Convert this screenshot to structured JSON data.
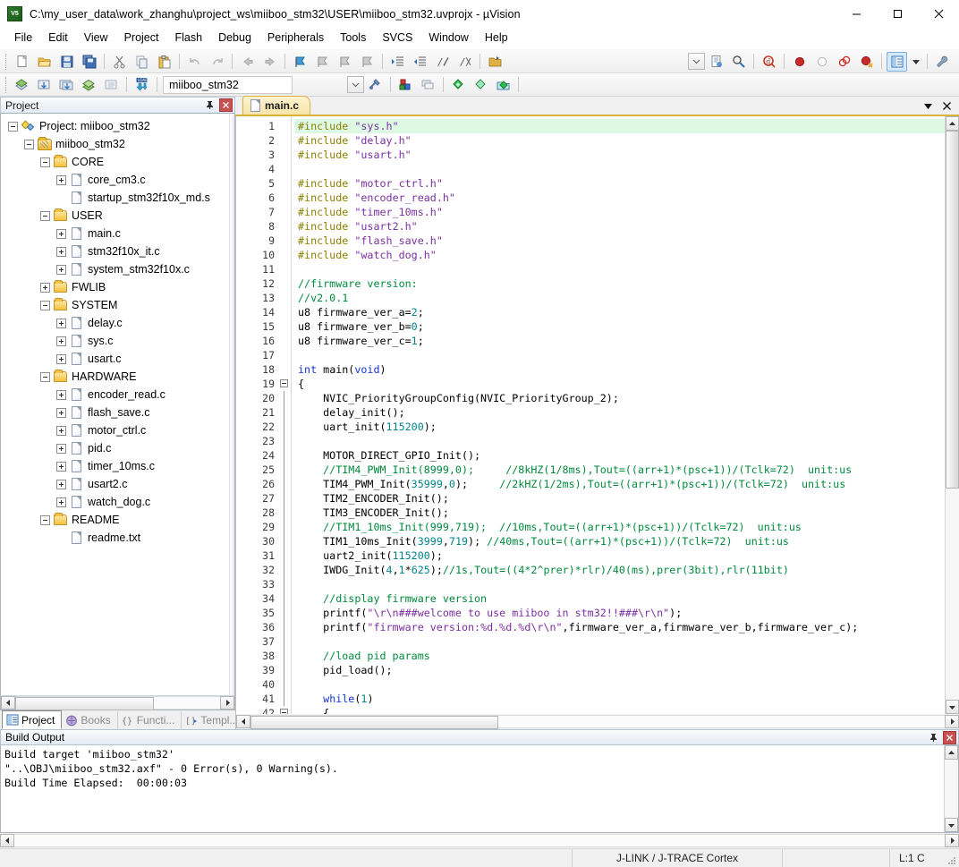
{
  "window": {
    "title": "C:\\my_user_data\\work_zhanghu\\project_ws\\miiboo_stm32\\USER\\miiboo_stm32.uvprojx - µVision",
    "app_icon": "uvision-icon",
    "minimize": "─",
    "maximize": "□",
    "close": "✕"
  },
  "menubar": {
    "items": [
      "File",
      "Edit",
      "View",
      "Project",
      "Flash",
      "Debug",
      "Peripherals",
      "Tools",
      "SVCS",
      "Window",
      "Help"
    ]
  },
  "toolbar_main": {
    "buttons": [
      {
        "name": "new-file",
        "glyph": "□"
      },
      {
        "name": "open-file",
        "glyph": "▤"
      },
      {
        "name": "save",
        "glyph": "■"
      },
      {
        "name": "save-all",
        "glyph": "▣"
      },
      {
        "name": "cut",
        "glyph": "✂"
      },
      {
        "name": "copy",
        "glyph": "❐"
      },
      {
        "name": "paste",
        "glyph": "⎘"
      },
      {
        "name": "undo",
        "glyph": "↶"
      },
      {
        "name": "redo",
        "glyph": "↷"
      },
      {
        "name": "navigate-backward",
        "glyph": "⇐"
      },
      {
        "name": "navigate-forward",
        "glyph": "⇒"
      },
      {
        "name": "insert-bookmark",
        "glyph": "⚑"
      },
      {
        "name": "previous-bookmark",
        "glyph": "⚑"
      },
      {
        "name": "next-bookmark",
        "glyph": "⚑"
      },
      {
        "name": "clear-bookmarks",
        "glyph": "⚑"
      },
      {
        "name": "indent",
        "glyph": "≡"
      },
      {
        "name": "outdent",
        "glyph": "≡"
      },
      {
        "name": "comment-selection",
        "glyph": "//"
      },
      {
        "name": "uncomment-selection",
        "glyph": "//"
      },
      {
        "name": "open-file-under-cursor",
        "glyph": "☰"
      }
    ],
    "right_buttons": [
      {
        "name": "configure-toolbox",
        "glyph": "⌵"
      },
      {
        "name": "find-in-files",
        "glyph": "⌗"
      },
      {
        "name": "find-replace",
        "glyph": "⌘"
      },
      {
        "name": "start-debug-session",
        "glyph": "ⓘ"
      },
      {
        "name": "insert-breakpoint",
        "glyph": "●"
      },
      {
        "name": "disable-breakpoint",
        "glyph": "○"
      },
      {
        "name": "disable-all-breakpoints",
        "glyph": "◍"
      },
      {
        "name": "kill-all-breakpoints",
        "glyph": "●"
      },
      {
        "name": "project-window-toggle",
        "glyph": "▤"
      },
      {
        "name": "project-window-dropdown",
        "glyph": "▾"
      },
      {
        "name": "configure-target-options",
        "glyph": "🔧"
      }
    ]
  },
  "toolbar_build": {
    "buttons": [
      {
        "name": "translate-file",
        "glyph": "◆"
      },
      {
        "name": "build-target",
        "glyph": "▦"
      },
      {
        "name": "rebuild-all-target-files",
        "glyph": "▦"
      },
      {
        "name": "batch-build",
        "glyph": "◈"
      },
      {
        "name": "stop-build",
        "glyph": "▧"
      },
      {
        "name": "download-to-flash",
        "glyph": "LOAD"
      }
    ],
    "target_value": "miiboo_stm32",
    "target_dropdown": "⌄",
    "after_buttons": [
      {
        "name": "manage-project-items",
        "glyph": "⚒"
      },
      {
        "name": "manage-runtime-environment",
        "glyph": "▰"
      },
      {
        "name": "select-software-packs",
        "glyph": "▥"
      },
      {
        "name": "pack-installer",
        "glyph": "◆"
      },
      {
        "name": "manage-multi-project",
        "glyph": "◇"
      },
      {
        "name": "manage-project-folders",
        "glyph": "◉"
      }
    ]
  },
  "project_panel": {
    "caption": "Project",
    "pin_glyph": "·",
    "close_glyph": "✕",
    "tree": [
      {
        "label": "Project: miiboo_stm32",
        "depth": 0,
        "icon": "project-root-icon",
        "expander": "minus"
      },
      {
        "label": "miiboo_stm32",
        "depth": 1,
        "icon": "target-icon",
        "expander": "minus"
      },
      {
        "label": "CORE",
        "depth": 2,
        "icon": "folder-icon",
        "expander": "minus"
      },
      {
        "label": "core_cm3.c",
        "depth": 3,
        "icon": "c-file-icon",
        "expander": "plus"
      },
      {
        "label": "startup_stm32f10x_md.s",
        "depth": 3,
        "icon": "asm-file-icon",
        "expander": "none"
      },
      {
        "label": "USER",
        "depth": 2,
        "icon": "folder-icon",
        "expander": "minus"
      },
      {
        "label": "main.c",
        "depth": 3,
        "icon": "c-file-icon",
        "expander": "plus"
      },
      {
        "label": "stm32f10x_it.c",
        "depth": 3,
        "icon": "c-file-icon",
        "expander": "plus"
      },
      {
        "label": "system_stm32f10x.c",
        "depth": 3,
        "icon": "c-file-icon",
        "expander": "plus"
      },
      {
        "label": "FWLIB",
        "depth": 2,
        "icon": "folder-icon",
        "expander": "plus"
      },
      {
        "label": "SYSTEM",
        "depth": 2,
        "icon": "folder-icon",
        "expander": "minus"
      },
      {
        "label": "delay.c",
        "depth": 3,
        "icon": "c-file-icon",
        "expander": "plus"
      },
      {
        "label": "sys.c",
        "depth": 3,
        "icon": "c-file-icon",
        "expander": "plus"
      },
      {
        "label": "usart.c",
        "depth": 3,
        "icon": "c-file-icon",
        "expander": "plus"
      },
      {
        "label": "HARDWARE",
        "depth": 2,
        "icon": "folder-icon",
        "expander": "minus"
      },
      {
        "label": "encoder_read.c",
        "depth": 3,
        "icon": "c-file-icon",
        "expander": "plus"
      },
      {
        "label": "flash_save.c",
        "depth": 3,
        "icon": "c-file-icon",
        "expander": "plus"
      },
      {
        "label": "motor_ctrl.c",
        "depth": 3,
        "icon": "c-file-icon",
        "expander": "plus"
      },
      {
        "label": "pid.c",
        "depth": 3,
        "icon": "c-file-icon",
        "expander": "plus"
      },
      {
        "label": "timer_10ms.c",
        "depth": 3,
        "icon": "c-file-icon",
        "expander": "plus"
      },
      {
        "label": "usart2.c",
        "depth": 3,
        "icon": "c-file-icon",
        "expander": "plus"
      },
      {
        "label": "watch_dog.c",
        "depth": 3,
        "icon": "c-file-icon",
        "expander": "plus"
      },
      {
        "label": "README",
        "depth": 2,
        "icon": "folder-icon",
        "expander": "minus"
      },
      {
        "label": "readme.txt",
        "depth": 3,
        "icon": "txt-file-icon",
        "expander": "none"
      }
    ],
    "bottom_tabs": [
      {
        "label": "Project",
        "icon": "project-tab-icon",
        "active": true
      },
      {
        "label": "Books",
        "icon": "books-tab-icon",
        "active": false
      },
      {
        "label": "Functi...",
        "icon": "functions-tab-icon",
        "active": false
      },
      {
        "label": "Templ...",
        "icon": "templates-tab-icon",
        "active": false
      }
    ]
  },
  "editor": {
    "tabs": [
      {
        "label": "main.c",
        "icon": "c-file-icon",
        "active": true
      }
    ],
    "tab_dropdown_glyph": "▾",
    "tab_close_glyph": "✕",
    "first_line": 1,
    "lines": [
      {
        "n": 1,
        "fold": "none",
        "cur": true,
        "tok": [
          [
            "pre",
            "#include"
          ],
          [
            "txt",
            " "
          ],
          [
            "str",
            "\"sys.h\""
          ]
        ]
      },
      {
        "n": 2,
        "fold": "none",
        "cur": false,
        "tok": [
          [
            "pre",
            "#include"
          ],
          [
            "txt",
            " "
          ],
          [
            "str",
            "\"delay.h\""
          ]
        ]
      },
      {
        "n": 3,
        "fold": "none",
        "cur": false,
        "tok": [
          [
            "pre",
            "#include"
          ],
          [
            "txt",
            " "
          ],
          [
            "str",
            "\"usart.h\""
          ]
        ]
      },
      {
        "n": 4,
        "fold": "none",
        "cur": false,
        "tok": []
      },
      {
        "n": 5,
        "fold": "none",
        "cur": false,
        "tok": [
          [
            "pre",
            "#include"
          ],
          [
            "txt",
            " "
          ],
          [
            "str",
            "\"motor_ctrl.h\""
          ]
        ]
      },
      {
        "n": 6,
        "fold": "none",
        "cur": false,
        "tok": [
          [
            "pre",
            "#include"
          ],
          [
            "txt",
            " "
          ],
          [
            "str",
            "\"encoder_read.h\""
          ]
        ]
      },
      {
        "n": 7,
        "fold": "none",
        "cur": false,
        "tok": [
          [
            "pre",
            "#include"
          ],
          [
            "txt",
            " "
          ],
          [
            "str",
            "\"timer_10ms.h\""
          ]
        ]
      },
      {
        "n": 8,
        "fold": "none",
        "cur": false,
        "tok": [
          [
            "pre",
            "#include"
          ],
          [
            "txt",
            " "
          ],
          [
            "str",
            "\"usart2.h\""
          ]
        ]
      },
      {
        "n": 9,
        "fold": "none",
        "cur": false,
        "tok": [
          [
            "pre",
            "#include"
          ],
          [
            "txt",
            " "
          ],
          [
            "str",
            "\"flash_save.h\""
          ]
        ]
      },
      {
        "n": 10,
        "fold": "none",
        "cur": false,
        "tok": [
          [
            "pre",
            "#include"
          ],
          [
            "txt",
            " "
          ],
          [
            "str",
            "\"watch_dog.h\""
          ]
        ]
      },
      {
        "n": 11,
        "fold": "none",
        "cur": false,
        "tok": []
      },
      {
        "n": 12,
        "fold": "none",
        "cur": false,
        "tok": [
          [
            "com",
            "//firmware version:"
          ]
        ]
      },
      {
        "n": 13,
        "fold": "none",
        "cur": false,
        "tok": [
          [
            "com",
            "//v2.0.1"
          ]
        ]
      },
      {
        "n": 14,
        "fold": "none",
        "cur": false,
        "tok": [
          [
            "txt",
            "u8 firmware_ver_a="
          ],
          [
            "num",
            "2"
          ],
          [
            "txt",
            ";"
          ]
        ]
      },
      {
        "n": 15,
        "fold": "none",
        "cur": false,
        "tok": [
          [
            "txt",
            "u8 firmware_ver_b="
          ],
          [
            "num",
            "0"
          ],
          [
            "txt",
            ";"
          ]
        ]
      },
      {
        "n": 16,
        "fold": "none",
        "cur": false,
        "tok": [
          [
            "txt",
            "u8 firmware_ver_c="
          ],
          [
            "num",
            "1"
          ],
          [
            "txt",
            ";"
          ]
        ]
      },
      {
        "n": 17,
        "fold": "none",
        "cur": false,
        "tok": []
      },
      {
        "n": 18,
        "fold": "none",
        "cur": false,
        "tok": [
          [
            "key",
            "int"
          ],
          [
            "txt",
            " main("
          ],
          [
            "key",
            "void"
          ],
          [
            "txt",
            ")"
          ]
        ]
      },
      {
        "n": 19,
        "fold": "box",
        "cur": false,
        "tok": [
          [
            "txt",
            "{"
          ]
        ]
      },
      {
        "n": 20,
        "fold": "line",
        "cur": false,
        "tok": [
          [
            "txt",
            "    NVIC_PriorityGroupConfig(NVIC_PriorityGroup_2);"
          ]
        ]
      },
      {
        "n": 21,
        "fold": "line",
        "cur": false,
        "tok": [
          [
            "txt",
            "    delay_init();"
          ]
        ]
      },
      {
        "n": 22,
        "fold": "line",
        "cur": false,
        "tok": [
          [
            "txt",
            "    uart_init("
          ],
          [
            "num",
            "115200"
          ],
          [
            "txt",
            ");"
          ]
        ]
      },
      {
        "n": 23,
        "fold": "line",
        "cur": false,
        "tok": []
      },
      {
        "n": 24,
        "fold": "line",
        "cur": false,
        "tok": [
          [
            "txt",
            "    MOTOR_DIRECT_GPIO_Init();"
          ]
        ]
      },
      {
        "n": 25,
        "fold": "line",
        "cur": false,
        "tok": [
          [
            "com",
            "    //TIM4_PWM_Init(8999,0);     //8kHZ(1/8ms),Tout=((arr+1)*(psc+1))/(Tclk=72)  unit:us"
          ]
        ]
      },
      {
        "n": 26,
        "fold": "line",
        "cur": false,
        "tok": [
          [
            "txt",
            "    TIM4_PWM_Init("
          ],
          [
            "num",
            "35999"
          ],
          [
            "txt",
            ","
          ],
          [
            "num",
            "0"
          ],
          [
            "txt",
            ");     "
          ],
          [
            "com",
            "//2kHZ(1/2ms),Tout=((arr+1)*(psc+1))/(Tclk=72)  unit:us"
          ]
        ]
      },
      {
        "n": 27,
        "fold": "line",
        "cur": false,
        "tok": [
          [
            "txt",
            "    TIM2_ENCODER_Init();"
          ]
        ]
      },
      {
        "n": 28,
        "fold": "line",
        "cur": false,
        "tok": [
          [
            "txt",
            "    TIM3_ENCODER_Init();"
          ]
        ]
      },
      {
        "n": 29,
        "fold": "line",
        "cur": false,
        "tok": [
          [
            "com",
            "    //TIM1_10ms_Init(999,719);  //10ms,Tout=((arr+1)*(psc+1))/(Tclk=72)  unit:us"
          ]
        ]
      },
      {
        "n": 30,
        "fold": "line",
        "cur": false,
        "tok": [
          [
            "txt",
            "    TIM1_10ms_Init("
          ],
          [
            "num",
            "3999"
          ],
          [
            "txt",
            ","
          ],
          [
            "num",
            "719"
          ],
          [
            "txt",
            "); "
          ],
          [
            "com",
            "//40ms,Tout=((arr+1)*(psc+1))/(Tclk=72)  unit:us"
          ]
        ]
      },
      {
        "n": 31,
        "fold": "line",
        "cur": false,
        "tok": [
          [
            "txt",
            "    uart2_init("
          ],
          [
            "num",
            "115200"
          ],
          [
            "txt",
            ");"
          ]
        ]
      },
      {
        "n": 32,
        "fold": "line",
        "cur": false,
        "tok": [
          [
            "txt",
            "    IWDG_Init("
          ],
          [
            "num",
            "4"
          ],
          [
            "txt",
            ","
          ],
          [
            "num",
            "1"
          ],
          [
            "txt",
            "*"
          ],
          [
            "num",
            "625"
          ],
          [
            "txt",
            ");"
          ],
          [
            "com",
            "//1s,Tout=((4*2^prer)*rlr)/40(ms),prer(3bit),rlr(11bit)"
          ]
        ]
      },
      {
        "n": 33,
        "fold": "line",
        "cur": false,
        "tok": []
      },
      {
        "n": 34,
        "fold": "line",
        "cur": false,
        "tok": [
          [
            "com",
            "    //display firmware version"
          ]
        ]
      },
      {
        "n": 35,
        "fold": "line",
        "cur": false,
        "tok": [
          [
            "txt",
            "    printf("
          ],
          [
            "str",
            "\"\\r\\n###welcome to use miiboo in stm32!!###\\r\\n\""
          ],
          [
            "txt",
            ");"
          ]
        ]
      },
      {
        "n": 36,
        "fold": "line",
        "cur": false,
        "tok": [
          [
            "txt",
            "    printf("
          ],
          [
            "str",
            "\"firmware version:%d.%d.%d\\r\\n\""
          ],
          [
            "txt",
            ",firmware_ver_a,firmware_ver_b,firmware_ver_c);"
          ]
        ]
      },
      {
        "n": 37,
        "fold": "line",
        "cur": false,
        "tok": []
      },
      {
        "n": 38,
        "fold": "line",
        "cur": false,
        "tok": [
          [
            "com",
            "    //load pid params"
          ]
        ]
      },
      {
        "n": 39,
        "fold": "line",
        "cur": false,
        "tok": [
          [
            "txt",
            "    pid_load();"
          ]
        ]
      },
      {
        "n": 40,
        "fold": "line",
        "cur": false,
        "tok": []
      },
      {
        "n": 41,
        "fold": "line",
        "cur": false,
        "tok": [
          [
            "txt",
            "    "
          ],
          [
            "key",
            "while"
          ],
          [
            "txt",
            "("
          ],
          [
            "num",
            "1"
          ],
          [
            "txt",
            ")"
          ]
        ]
      },
      {
        "n": 42,
        "fold": "box",
        "cur": false,
        "tok": [
          [
            "txt",
            "    {"
          ]
        ]
      }
    ]
  },
  "build_output": {
    "caption": "Build Output",
    "pin_glyph": "·",
    "close_glyph": "✕",
    "lines": [
      "Build target 'miiboo_stm32'",
      "\"..\\OBJ\\miiboo_stm32.axf\" - 0 Error(s), 0 Warning(s).",
      "Build Time Elapsed:  00:00:03"
    ]
  },
  "statusbar": {
    "left": "",
    "debugger": "J-LINK / J-TRACE Cortex",
    "spacer": "",
    "caret": "L:1 C"
  }
}
